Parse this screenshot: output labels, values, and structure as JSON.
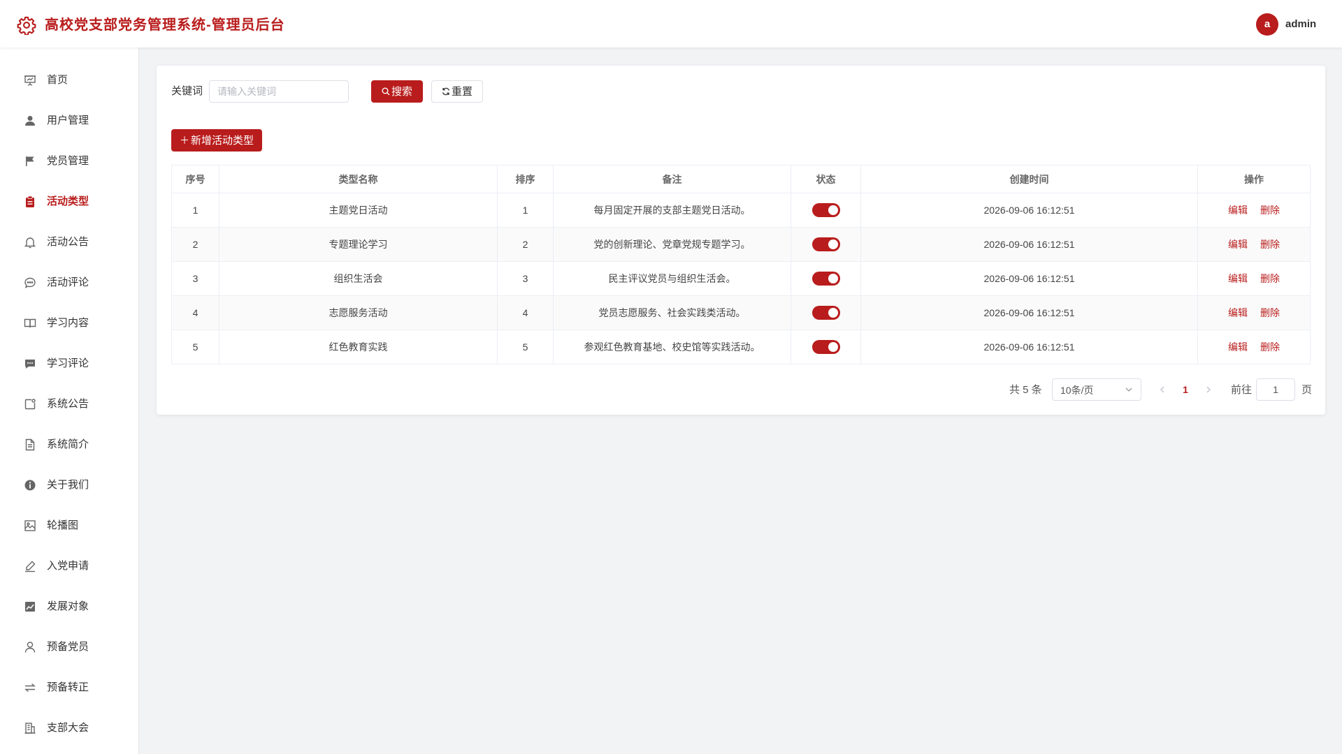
{
  "header": {
    "title": "高校党支部党务管理系统-管理员后台",
    "avatar_letter": "a",
    "username": "admin",
    "accent_color": "#b91c1c"
  },
  "sidebar": {
    "items": [
      {
        "label": "首页",
        "icon": "presentation-icon",
        "active": false
      },
      {
        "label": "用户管理",
        "icon": "user-icon",
        "active": false
      },
      {
        "label": "党员管理",
        "icon": "flag-icon",
        "active": false
      },
      {
        "label": "活动类型",
        "icon": "clipboard-icon",
        "active": true
      },
      {
        "label": "活动公告",
        "icon": "bell-icon",
        "active": false
      },
      {
        "label": "活动评论",
        "icon": "chat-bubble-icon",
        "active": false
      },
      {
        "label": "学习内容",
        "icon": "book-icon",
        "active": false
      },
      {
        "label": "学习评论",
        "icon": "comment-icon",
        "active": false
      },
      {
        "label": "系统公告",
        "icon": "notice-icon",
        "active": false
      },
      {
        "label": "系统简介",
        "icon": "document-icon",
        "active": false
      },
      {
        "label": "关于我们",
        "icon": "info-icon",
        "active": false
      },
      {
        "label": "轮播图",
        "icon": "image-icon",
        "active": false
      },
      {
        "label": "入党申请",
        "icon": "edit-pen-icon",
        "active": false
      },
      {
        "label": "发展对象",
        "icon": "trend-chart-icon",
        "active": false
      },
      {
        "label": "预备党员",
        "icon": "user-outline-icon",
        "active": false
      },
      {
        "label": "预备转正",
        "icon": "switch-arrows-icon",
        "active": false
      },
      {
        "label": "支部大会",
        "icon": "building-icon",
        "active": false
      }
    ]
  },
  "search": {
    "label": "关键词",
    "placeholder": "请输入关键词",
    "value": "",
    "search_label": "搜索",
    "reset_label": "重置"
  },
  "toolbar": {
    "add_label": "新增活动类型"
  },
  "table": {
    "columns": [
      "序号",
      "类型名称",
      "排序",
      "备注",
      "状态",
      "创建时间",
      "操作"
    ],
    "rows": [
      {
        "index": "1",
        "name": "主题党日活动",
        "sort": "1",
        "remark": "每月固定开展的支部主题党日活动。",
        "enabled": true,
        "created": "2026-09-06 16:12:51"
      },
      {
        "index": "2",
        "name": "专题理论学习",
        "sort": "2",
        "remark": "党的创新理论、党章党规专题学习。",
        "enabled": true,
        "created": "2026-09-06 16:12:51"
      },
      {
        "index": "3",
        "name": "组织生活会",
        "sort": "3",
        "remark": "民主评议党员与组织生活会。",
        "enabled": true,
        "created": "2026-09-06 16:12:51"
      },
      {
        "index": "4",
        "name": "志愿服务活动",
        "sort": "4",
        "remark": "党员志愿服务、社会实践类活动。",
        "enabled": true,
        "created": "2026-09-06 16:12:51"
      },
      {
        "index": "5",
        "name": "红色教育实践",
        "sort": "5",
        "remark": "参观红色教育基地、校史馆等实践活动。",
        "enabled": true,
        "created": "2026-09-06 16:12:51"
      }
    ],
    "edit_label": "编辑",
    "delete_label": "删除"
  },
  "pagination": {
    "total_text": "共 5 条",
    "page_size_text": "10条/页",
    "current_page": "1",
    "goto_label": "前往",
    "goto_value": "1",
    "page_suffix": "页"
  }
}
